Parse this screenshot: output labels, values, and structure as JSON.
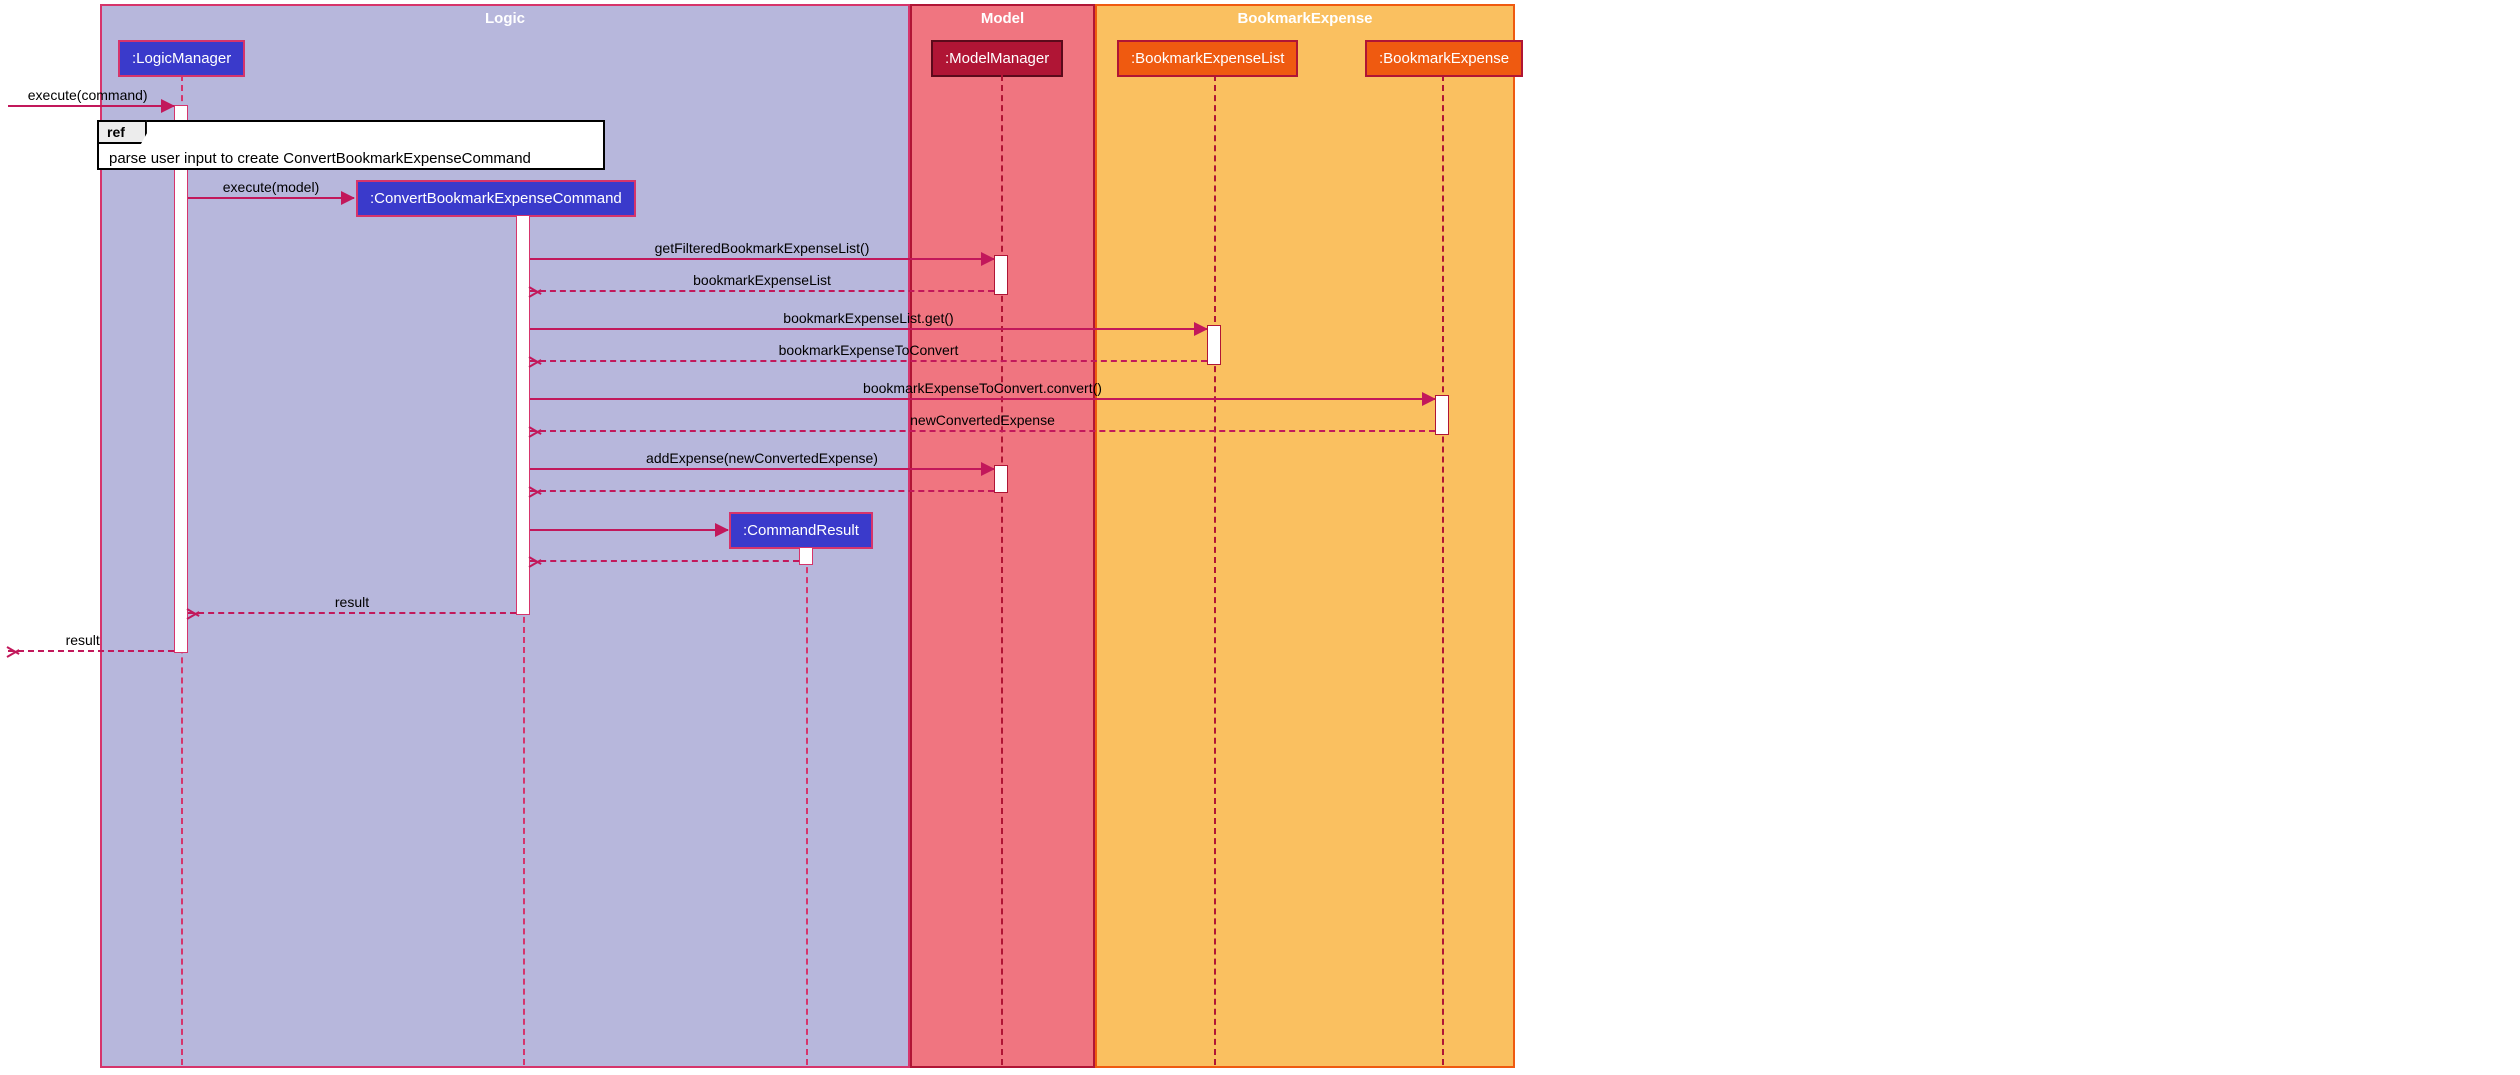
{
  "containers": {
    "logic": "Logic",
    "model": "Model",
    "bookmark": "BookmarkExpense"
  },
  "lifelines": {
    "logicManager": ":LogicManager",
    "convertCmd": ":ConvertBookmarkExpenseCommand",
    "commandResult": ":CommandResult",
    "modelManager": ":ModelManager",
    "bookmarkList": ":BookmarkExpenseList",
    "bookmarkExpense": ":BookmarkExpense"
  },
  "ref": {
    "label": "ref",
    "text": "parse user input to create ConvertBookmarkExpenseCommand"
  },
  "messages": {
    "m1": "execute(command)",
    "m2": "execute(model)",
    "m3": "getFilteredBookmarkExpenseList()",
    "m4": "bookmarkExpenseList",
    "m5": "bookmarkExpenseList.get()",
    "m6": "bookmarkExpenseToConvert",
    "m7": "bookmarkExpenseToConvert.convert()",
    "m8": "newConvertedExpense",
    "m9": "addExpense(newConvertedExpense)",
    "m10": "result",
    "m11": "result"
  },
  "chart_data": {
    "type": "sequence-diagram",
    "participants": [
      {
        "group": "Logic",
        "name": ":LogicManager"
      },
      {
        "group": "Logic",
        "name": ":ConvertBookmarkExpenseCommand",
        "created_by_message": 2
      },
      {
        "group": "Logic",
        "name": ":CommandResult",
        "created_by_message": 11
      },
      {
        "group": "Model",
        "name": ":ModelManager"
      },
      {
        "group": "BookmarkExpense",
        "name": ":BookmarkExpenseList"
      },
      {
        "group": "BookmarkExpense",
        "name": ":BookmarkExpense"
      }
    ],
    "fragments": [
      {
        "type": "ref",
        "text": "parse user input to create ConvertBookmarkExpenseCommand",
        "after_message": 1
      }
    ],
    "messages": [
      {
        "n": 1,
        "from": "external",
        "to": ":LogicManager",
        "label": "execute(command)",
        "kind": "call"
      },
      {
        "n": 2,
        "from": ":LogicManager",
        "to": ":ConvertBookmarkExpenseCommand",
        "label": "execute(model)",
        "kind": "call",
        "creates": true
      },
      {
        "n": 3,
        "from": ":ConvertBookmarkExpenseCommand",
        "to": ":ModelManager",
        "label": "getFilteredBookmarkExpenseList()",
        "kind": "call"
      },
      {
        "n": 4,
        "from": ":ModelManager",
        "to": ":ConvertBookmarkExpenseCommand",
        "label": "bookmarkExpenseList",
        "kind": "return"
      },
      {
        "n": 5,
        "from": ":ConvertBookmarkExpenseCommand",
        "to": ":BookmarkExpenseList",
        "label": "bookmarkExpenseList.get()",
        "kind": "call"
      },
      {
        "n": 6,
        "from": ":BookmarkExpenseList",
        "to": ":ConvertBookmarkExpenseCommand",
        "label": "bookmarkExpenseToConvert",
        "kind": "return"
      },
      {
        "n": 7,
        "from": ":ConvertBookmarkExpenseCommand",
        "to": ":BookmarkExpense",
        "label": "bookmarkExpenseToConvert.convert()",
        "kind": "call"
      },
      {
        "n": 8,
        "from": ":BookmarkExpense",
        "to": ":ConvertBookmarkExpenseCommand",
        "label": "newConvertedExpense",
        "kind": "return"
      },
      {
        "n": 9,
        "from": ":ConvertBookmarkExpenseCommand",
        "to": ":ModelManager",
        "label": "addExpense(newConvertedExpense)",
        "kind": "call"
      },
      {
        "n": 10,
        "from": ":ModelManager",
        "to": ":ConvertBookmarkExpenseCommand",
        "label": "",
        "kind": "return"
      },
      {
        "n": 11,
        "from": ":ConvertBookmarkExpenseCommand",
        "to": ":CommandResult",
        "label": "",
        "kind": "call",
        "creates": true
      },
      {
        "n": 12,
        "from": ":CommandResult",
        "to": ":ConvertBookmarkExpenseCommand",
        "label": "",
        "kind": "return"
      },
      {
        "n": 13,
        "from": ":ConvertBookmarkExpenseCommand",
        "to": ":LogicManager",
        "label": "result",
        "kind": "return"
      },
      {
        "n": 14,
        "from": ":LogicManager",
        "to": "external",
        "label": "result",
        "kind": "return"
      }
    ]
  }
}
